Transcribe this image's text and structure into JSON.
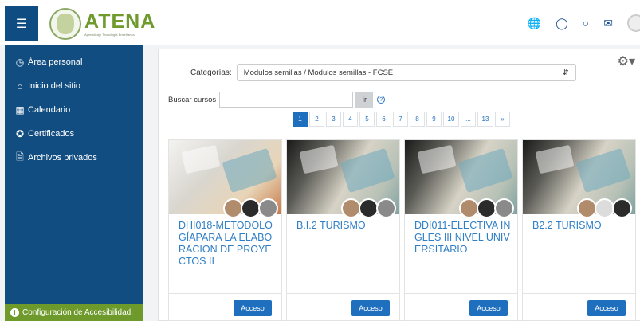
{
  "header": {
    "menu_icon": "hamburger-icon",
    "logo_title": "ATENA",
    "logo_tagline": "Aprendizaje Tecnología Enseñanza",
    "icons": [
      "globe-icon",
      "bell-icon",
      "chat-icon",
      "mail-icon",
      "user-avatar"
    ]
  },
  "sidebar": {
    "items": [
      {
        "label": "Área personal",
        "icon": "dashboard-icon"
      },
      {
        "label": "Inicio del sitio",
        "icon": "home-icon"
      },
      {
        "label": "Calendario",
        "icon": "calendar-icon"
      },
      {
        "label": "Certificados",
        "icon": "certificate-icon"
      },
      {
        "label": "Archivos privados",
        "icon": "files-icon"
      }
    ],
    "accessibility_label": "Configuración de Accesibilidad."
  },
  "main": {
    "category_label": "Categorías:",
    "category_value": "Modulos semillas / Modulos semillas - FCSE",
    "search_label": "Buscar cursos",
    "search_placeholder": "",
    "search_button": "Ir",
    "pagination": [
      "1",
      "2",
      "3",
      "4",
      "5",
      "6",
      "7",
      "8",
      "9",
      "10",
      "...",
      "13",
      "»"
    ],
    "active_page": "1"
  },
  "courses": [
    {
      "title": "DHI018-METODOLOGÍAPARA LA ELABORACION DE PROYECTOS II",
      "button": "Acceso"
    },
    {
      "title": "B.I.2 TURISMO",
      "button": "Acceso"
    },
    {
      "title": "DDI011-ELECTIVA INGLES III NIVEL UNIVERSITARIO",
      "button": "Acceso"
    },
    {
      "title": "B2.2 TURISMO",
      "button": "Acceso"
    }
  ],
  "colors": {
    "brand_blue": "#114d81",
    "brand_green": "#6d9a2b",
    "link_blue": "#2f7fc6",
    "button_blue": "#1f6fbf"
  }
}
